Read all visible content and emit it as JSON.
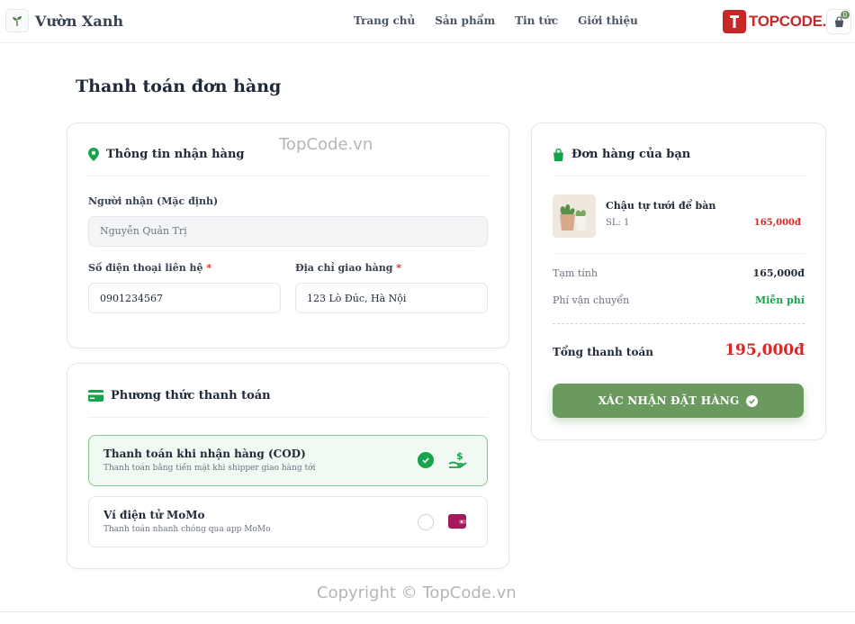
{
  "header": {
    "brand_name": "Vườn Xanh",
    "nav": [
      "Trang chủ",
      "Sản phẩm",
      "Tin tức",
      "Giới thiệu"
    ],
    "cart_count": "0",
    "partner_logo_text": "TOPCODE.VN"
  },
  "page": {
    "title": "Thanh toán đơn hàng"
  },
  "shipping": {
    "title": "Thông tin nhận hàng",
    "recipient_label": "Người nhận (Mặc định)",
    "recipient_value": "Nguyễn Quản Trị",
    "phone_label": "Số điện thoại liên hệ",
    "phone_value": "0901234567",
    "address_label": "Địa chỉ giao hàng",
    "address_value": "123 Lò Đúc, Hà Nội",
    "required_mark": "*"
  },
  "payment": {
    "title": "Phương thức thanh toán",
    "options": [
      {
        "name": "Thanh toán khi nhận hàng (COD)",
        "desc": "Thanh toán bằng tiền mặt khi shipper giao hàng tới",
        "selected": true,
        "icon": "cash-hand-icon"
      },
      {
        "name": "Ví điện tử MoMo",
        "desc": "Thanh toán nhanh chóng qua app MoMo",
        "selected": false,
        "icon": "wallet-icon"
      }
    ]
  },
  "order": {
    "title": "Đơn hàng của bạn",
    "item": {
      "name": "Chậu tự tưới để bàn",
      "qty": "SL: 1",
      "price": "165,000đ"
    },
    "subtotal_label": "Tạm tính",
    "subtotal_value": "165,000đ",
    "shipping_label": "Phí vận chuyển",
    "shipping_value": "Miễn phí",
    "total_label": "Tổng thanh toán",
    "total_value": "195,000đ",
    "confirm_label": "XÁC NHẬN ĐẶT HÀNG"
  },
  "watermarks": {
    "top": "TopCode.vn",
    "bottom": "Copyright © TopCode.vn"
  },
  "colors": {
    "accent_green": "#6b9a5f",
    "price_red": "#dc2626",
    "success_green": "#16a34a",
    "momo_pink": "#a3195b"
  }
}
